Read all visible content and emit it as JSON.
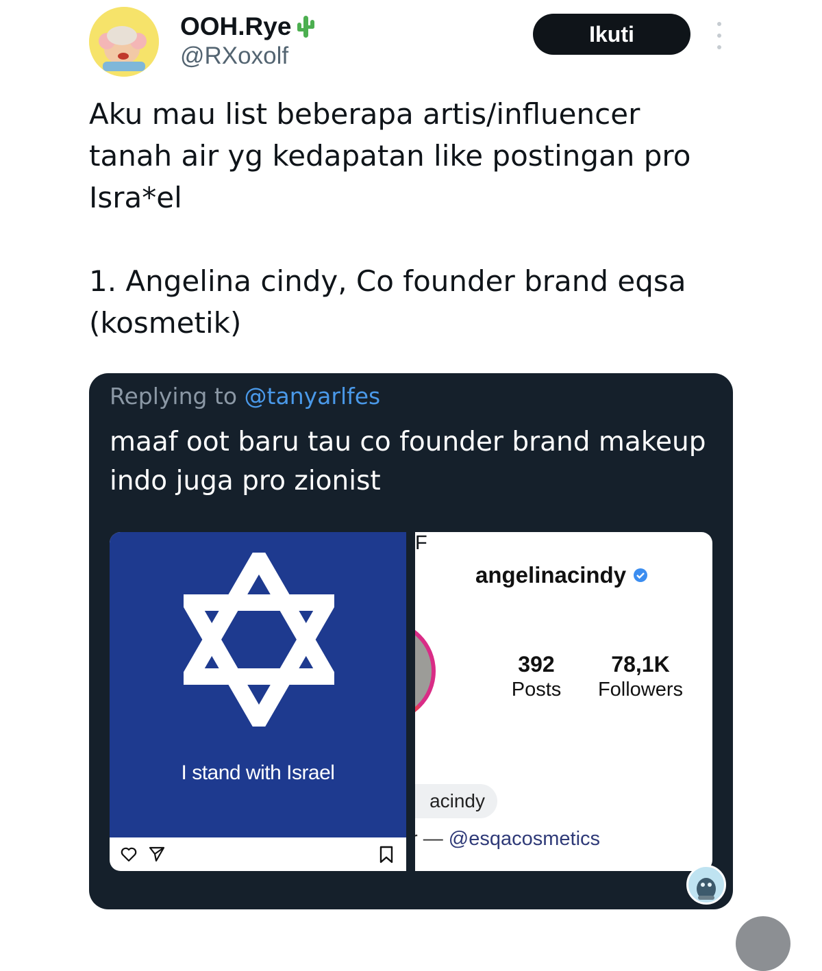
{
  "tweet": {
    "author": {
      "display_name": "OOH.Rye",
      "name_emoji": "cactus-icon",
      "handle": "@RXoxolf",
      "avatar": "avatar"
    },
    "follow_label": "Ikuti",
    "more_icon": "more-icon",
    "text_line1": "Aku mau list beberapa artis/influencer",
    "text_line2": "tanah air yg kedapatan like postingan pro",
    "text_line3": "Isra*el",
    "text_line4": "1. Angelina cindy, Co founder brand eqsa",
    "text_line5": "(kosmetik)"
  },
  "embedded_screenshot": {
    "replying_prefix": "Replying to",
    "replying_mention": "@tanyarlfes",
    "reply_line1": "maaf oot baru tau co founder brand makeup",
    "reply_line2": "indo juga pro zionist",
    "post": {
      "caption": "I stand with Israel",
      "icons": [
        "heart-icon",
        "send-icon",
        "bookmark-icon"
      ],
      "flag_color": "#1e3a8f"
    },
    "profile": {
      "username": "angelinacindy",
      "verified": true,
      "posts_count": "392",
      "posts_label": "Posts",
      "followers_count": "78,1K",
      "followers_label": "Followers",
      "following_partial": "F",
      "name_chip": "acindy",
      "bio_partial": "r",
      "bio_dash": " — ",
      "bio_mention": "@esqacosmetics"
    }
  },
  "colors": {
    "card_bg": "#15202b",
    "mention": "#4a99e9",
    "follow_bg": "#0f1419"
  }
}
